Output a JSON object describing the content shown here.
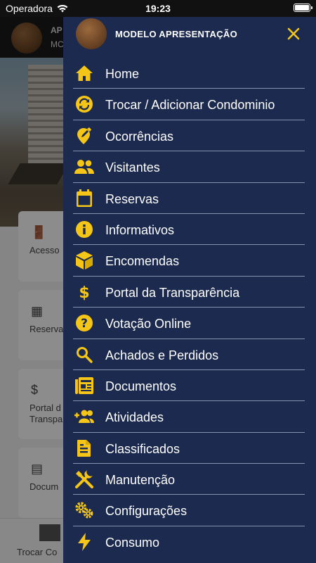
{
  "status": {
    "carrier": "Operadora",
    "time": "19:23"
  },
  "background_app": {
    "header_line1": "AP",
    "header_line2": "MC",
    "cards": [
      "Acesso",
      "Reserva",
      "Portal d",
      "Transpa",
      "Docum"
    ],
    "tab_label": "Trocar Co"
  },
  "drawer": {
    "title": "MODELO APRESENTAÇÃO",
    "close_icon": "close-icon",
    "accent": "#f5c518",
    "background": "#1b2a4e",
    "items": [
      {
        "label": "Home",
        "icon": "home-icon"
      },
      {
        "label": "Trocar / Adicionar Condominio",
        "icon": "sync-icon"
      },
      {
        "label": "Ocorrências",
        "icon": "location-edit-icon"
      },
      {
        "label": "Visitantes",
        "icon": "people-icon"
      },
      {
        "label": "Reservas",
        "icon": "calendar-icon"
      },
      {
        "label": "Informativos",
        "icon": "info-icon"
      },
      {
        "label": "Encomendas",
        "icon": "package-icon"
      },
      {
        "label": "Portal da Transparência",
        "icon": "dollar-icon"
      },
      {
        "label": "Votação Online",
        "icon": "question-icon"
      },
      {
        "label": "Achados e Perdidos",
        "icon": "search-icon"
      },
      {
        "label": "Documentos",
        "icon": "newspaper-icon"
      },
      {
        "label": "Atividades",
        "icon": "group-add-icon"
      },
      {
        "label": "Classificados",
        "icon": "document-icon"
      },
      {
        "label": "Manutenção",
        "icon": "tools-icon"
      },
      {
        "label": "Configurações",
        "icon": "gears-icon"
      },
      {
        "label": "Consumo",
        "icon": "bolt-icon"
      }
    ]
  }
}
